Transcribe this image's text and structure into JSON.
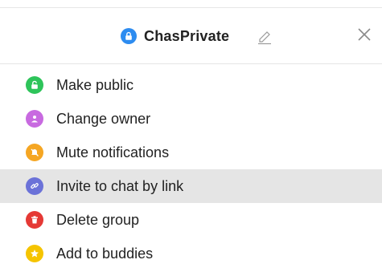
{
  "header": {
    "title": "ChasPrivate",
    "title_icon": "lock-icon",
    "edit_icon": "pencil-icon",
    "close_icon": "close-icon"
  },
  "menu": {
    "items": [
      {
        "label": "Make public",
        "icon": "unlock-icon",
        "color": "#2ec45a"
      },
      {
        "label": "Change owner",
        "icon": "user-change-icon",
        "color": "#c86ae0"
      },
      {
        "label": "Mute notifications",
        "icon": "mute-icon",
        "color": "#f5a623"
      },
      {
        "label": "Invite to chat by link",
        "icon": "link-icon",
        "color": "#6b72d8",
        "highlighted": true
      },
      {
        "label": "Delete group",
        "icon": "trash-icon",
        "color": "#e53935"
      },
      {
        "label": "Add to buddies",
        "icon": "star-icon",
        "color": "#f5c400"
      }
    ]
  },
  "colors": {
    "title_lock": "#2d8cf0",
    "highlight_bg": "#e5e5e5",
    "divider": "#e6e6e6"
  }
}
